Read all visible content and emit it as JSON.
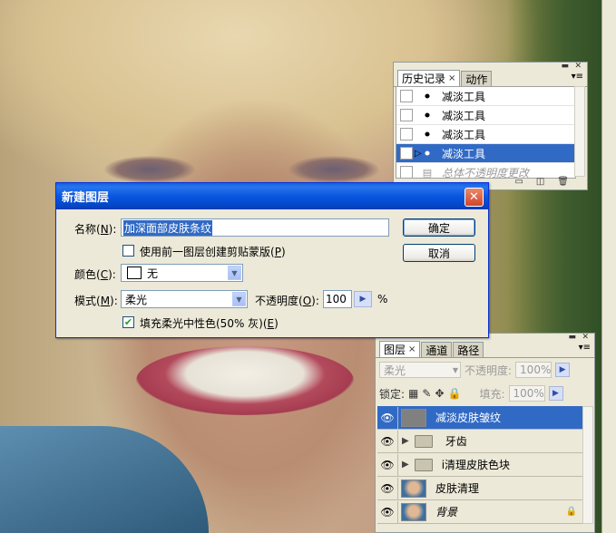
{
  "history_panel": {
    "tabs": [
      {
        "label": "历史记录",
        "close": "×"
      },
      {
        "label": "动作"
      }
    ],
    "items": [
      {
        "label": "减淡工具",
        "state": "normal"
      },
      {
        "label": "减淡工具",
        "state": "normal"
      },
      {
        "label": "减淡工具",
        "state": "normal"
      },
      {
        "label": "减淡工具",
        "state": "selected"
      },
      {
        "label": "总体不透明度更改",
        "state": "dimmed"
      }
    ],
    "footer_icons": [
      "snapshot-icon",
      "new-document-icon",
      "trash-icon"
    ]
  },
  "dialog": {
    "title": "新建图层",
    "close_glyph": "✕",
    "name_label": "名称(",
    "name_key": "N",
    "name_label_end": "):",
    "name_value": "加深面部皮肤条纹",
    "clip_label": "使用前一图层创建剪贴蒙版(",
    "clip_key": "P",
    "clip_label_end": ")",
    "clip_checked": false,
    "color_label": "颜色(",
    "color_key": "C",
    "color_label_end": "):",
    "color_value": "无",
    "mode_label": "模式(",
    "mode_key": "M",
    "mode_label_end": "):",
    "mode_value": "柔光",
    "opacity_label": "不透明度(",
    "opacity_key": "O",
    "opacity_label_end": "):",
    "opacity_value": "100",
    "opacity_unit": "%",
    "fill_label": "填充柔光中性色(50% 灰)(",
    "fill_key": "E",
    "fill_label_end": ")",
    "fill_checked": true,
    "ok_label": "确定",
    "cancel_label": "取消"
  },
  "layers_panel": {
    "tabs": [
      {
        "label": "图层",
        "close": "×"
      },
      {
        "label": "通道"
      },
      {
        "label": "路径"
      }
    ],
    "blend_mode": "柔光",
    "opacity_label": "不透明度:",
    "opacity_value": "100%",
    "lock_label": "锁定:",
    "fill_label": "填充:",
    "fill_value": "100%",
    "layers": [
      {
        "name": "减淡皮肤皱纹",
        "type": "gray",
        "selected": true
      },
      {
        "name": "牙齿",
        "type": "group",
        "selected": false
      },
      {
        "name": "i清理皮肤色块",
        "type": "group",
        "selected": false
      },
      {
        "name": "皮肤清理",
        "type": "photo",
        "selected": false
      },
      {
        "name": "背景",
        "type": "photo",
        "selected": false,
        "italic": true,
        "locked": true
      }
    ]
  },
  "colors": {
    "titlebar": "#0a56e0",
    "selection": "#316ac5",
    "panel": "#ece9d8"
  }
}
